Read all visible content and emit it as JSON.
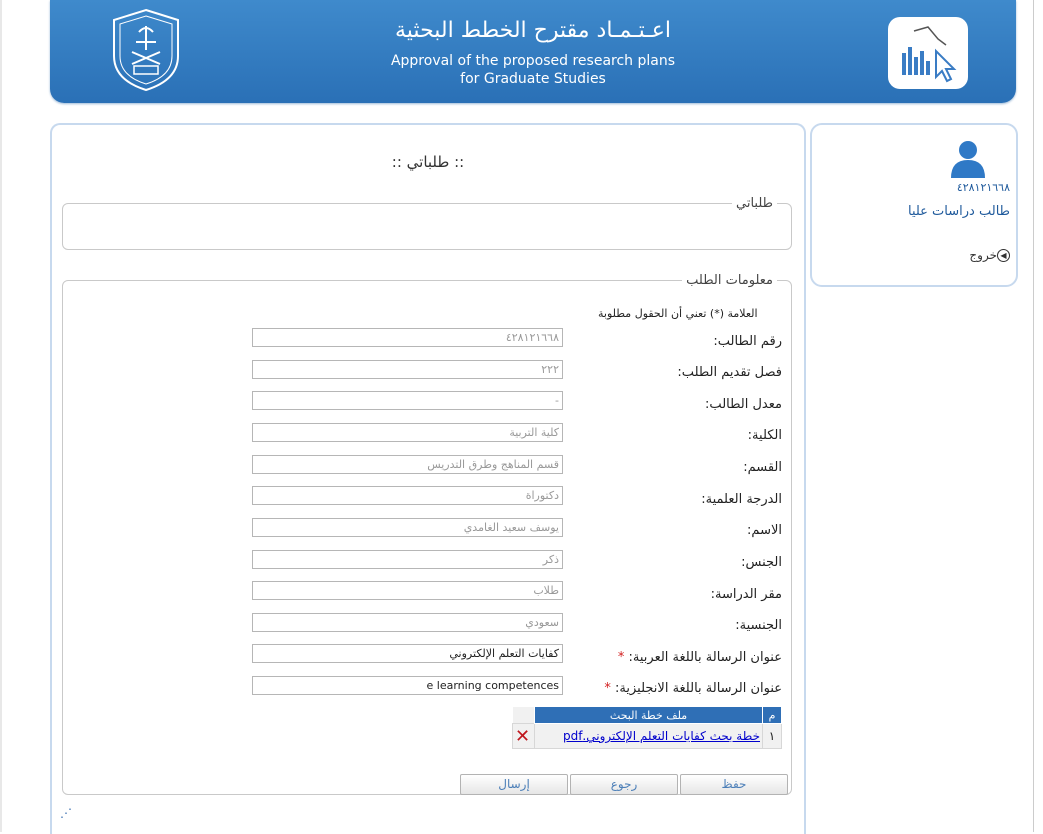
{
  "header": {
    "title_ar": "اعـتـمـاد مقترح الخطط البحثية",
    "title_en_line1": "Approval of the proposed research plans",
    "title_en_line2": "for Graduate Studies"
  },
  "panel": {
    "title": ":: طلباتي ::",
    "requests_legend": "طلباتي",
    "info_legend": "معلومات الطلب",
    "required_note": "العلامة (*) تعني أن الحقول مطلوبة"
  },
  "fields": [
    {
      "label": "رقم الطالب:",
      "value": "٤٢٨١٢١٦٦٨",
      "required": false
    },
    {
      "label": "فصل تقديم الطلب:",
      "value": "٢٢٢",
      "required": false
    },
    {
      "label": "معدل الطالب:",
      "value": "-",
      "required": false
    },
    {
      "label": "الكلية:",
      "value": "كلية التربية",
      "required": false
    },
    {
      "label": "القسم:",
      "value": "قسم المناهج وطرق التدريس",
      "required": false
    },
    {
      "label": "الدرجة العلمية:",
      "value": "دكتوراة",
      "required": false
    },
    {
      "label": "الاسم:",
      "value": "يوسف سعيد الغامدي",
      "required": false
    },
    {
      "label": "الجنس:",
      "value": "ذكر",
      "required": false
    },
    {
      "label": "مقر الدراسة:",
      "value": "طلاب",
      "required": false
    },
    {
      "label": "الجنسية:",
      "value": "سعودي",
      "required": false
    },
    {
      "label": "عنوان الرسالة باللغة العربية:",
      "value": "كفايات التعلم الإلكتروني",
      "required": true
    },
    {
      "label": "عنوان الرسالة باللغة الانجليزية:",
      "value": "e learning competences",
      "required": true
    }
  ],
  "required_mark": "*",
  "files_table": {
    "col_num": "م",
    "col_file": "ملف خطة البحث",
    "rows": [
      {
        "num": "١",
        "file_name": "خطة بحث كفايات التعلم الإلكتروني.pdf"
      }
    ]
  },
  "buttons": {
    "save": "حفظ",
    "back": "رجوع",
    "send": "إرسال"
  },
  "user": {
    "id": "٤٢٨١٢١٦٦٨",
    "role": "طالب دراسات عليا",
    "logout": "خروج"
  },
  "colors": {
    "header_blue": "#3580c4",
    "table_header": "#2f6fb6",
    "required": "#d21f1f",
    "link": "#0000cc"
  }
}
